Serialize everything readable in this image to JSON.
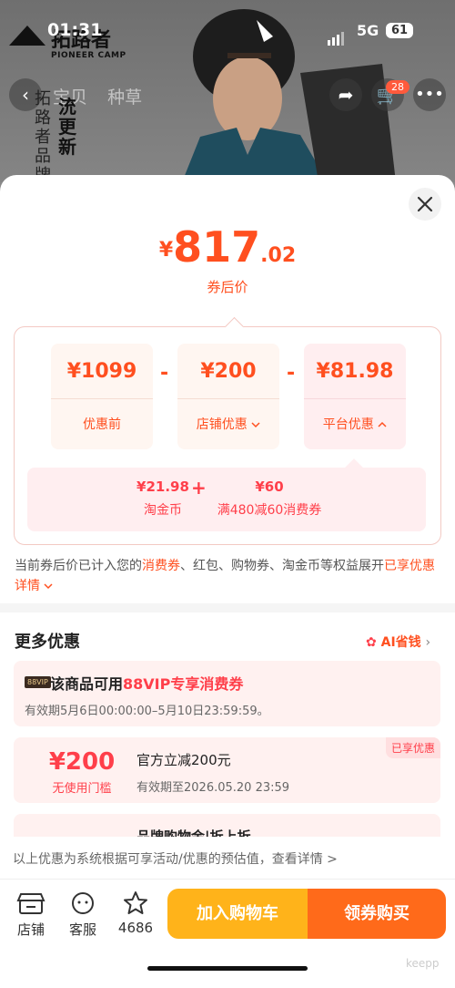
{
  "status_bar": {
    "time": "01:31",
    "network": "5G",
    "battery": "61"
  },
  "background": {
    "brand_name": "拓路者",
    "brand_sub": "PIONEER CAMP",
    "tabs": [
      "宝贝",
      "种草"
    ],
    "vertical_text_1": "拓路者品牌",
    "vertical_text_2": "㳘更新",
    "cart_badge": "28"
  },
  "sheet": {
    "close_icon": "close-icon",
    "final_price": {
      "yen": "¥",
      "integer": "817",
      "decimal": ".02",
      "label": "券后价"
    },
    "breakdown": [
      {
        "amount": "¥1099",
        "label": "优惠前"
      },
      {
        "amount": "¥200",
        "label": "店铺优惠",
        "chevron": "chevron-down-icon"
      },
      {
        "amount": "¥81.98",
        "label": "平台优惠",
        "chevron": "chevron-up-icon"
      }
    ],
    "operators": [
      "-",
      "-"
    ],
    "platform_detail": [
      {
        "value": "¥21.98",
        "desc": "淘金币"
      },
      {
        "value": "¥60",
        "desc": "满480减60消费券"
      }
    ],
    "plus": "+",
    "note": {
      "prefix": "当前券后价已计入您的",
      "highlight": "消费券",
      "middle": "、红包、购物券、淘金币等权益展开",
      "link": "已享优惠详情"
    },
    "more_section": {
      "title": "更多优惠",
      "ai_link": "AI省钱",
      "offers": [
        {
          "tag": "88VIP",
          "title_prefix": "该商品可用",
          "title_highlight": "88VIP专享消费券",
          "subtitle": "有效期5月6日00:00:00–5月10日23:59:59。"
        },
        {
          "amount": "¥200",
          "condition": "无使用门槛",
          "title": "官方立减200元",
          "subtitle": "有效期至2026.05.20 23:59",
          "badge": "已享优惠"
        },
        {
          "title": "品牌购物金|折上折"
        }
      ]
    },
    "disclaimer": "以上优惠为系统根据可享活动/优惠的预估值，查看详情 >"
  },
  "bottom_bar": {
    "shop": "店铺",
    "service": "客服",
    "favorites_count": "4686",
    "add_to_cart": "加入购物车",
    "buy_with_coupon": "领券购买"
  },
  "watermark": "keepp",
  "colors": {
    "accent": "#ff4f1f",
    "red": "#ff3f4a",
    "cart_button": "#ffb31a",
    "buy_button": "#ff6a1a"
  }
}
